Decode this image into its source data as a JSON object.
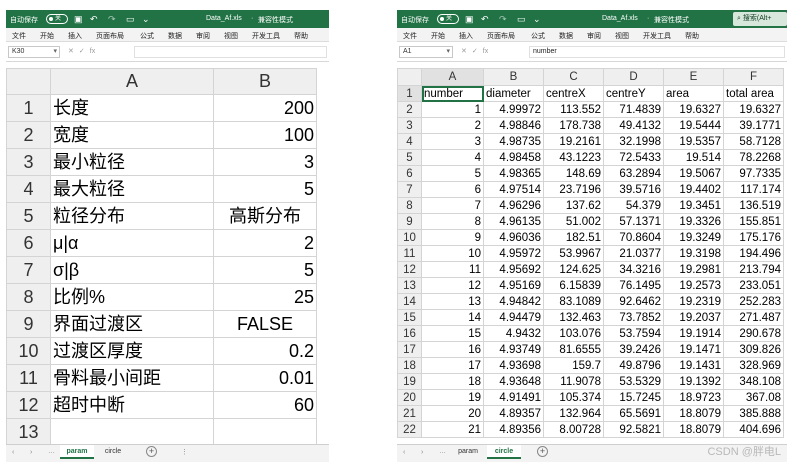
{
  "left_window": {
    "autosave_label": "自动保存",
    "autosave_state": "关",
    "file_title": "Data_Af.xls",
    "mode": "兼容性模式",
    "menu": [
      "文件",
      "开始",
      "插入",
      "页面布局",
      "公式",
      "数据",
      "审阅",
      "视图",
      "开发工具",
      "帮助"
    ],
    "name_box": "K30",
    "formula_value": "",
    "columns": [
      "A",
      "B"
    ],
    "rows": [
      {
        "row": "1",
        "a": "长度",
        "b": "200"
      },
      {
        "row": "2",
        "a": "宽度",
        "b": "100"
      },
      {
        "row": "3",
        "a": "最小粒径",
        "b": "3"
      },
      {
        "row": "4",
        "a": "最大粒径",
        "b": "5"
      },
      {
        "row": "5",
        "a": "粒径分布",
        "b": "高斯分布"
      },
      {
        "row": "6",
        "a": "μ|α",
        "b": "2"
      },
      {
        "row": "7",
        "a": "σ|β",
        "b": "5"
      },
      {
        "row": "8",
        "a": "比例%",
        "b": "25"
      },
      {
        "row": "9",
        "a": "界面过渡区",
        "b": "FALSE"
      },
      {
        "row": "10",
        "a": "过渡区厚度",
        "b": "0.2"
      },
      {
        "row": "11",
        "a": "骨料最小间距",
        "b": "0.01"
      },
      {
        "row": "12",
        "a": "超时中断",
        "b": "60"
      },
      {
        "row": "13",
        "a": "",
        "b": ""
      }
    ],
    "sheet_tabs": [
      "param",
      "circle"
    ],
    "active_tab": "param"
  },
  "right_window": {
    "autosave_label": "自动保存",
    "autosave_state": "关",
    "file_title": "Data_Af.xls",
    "mode": "兼容性模式",
    "search_placeholder": "搜索(Alt+",
    "menu": [
      "文件",
      "开始",
      "插入",
      "页面布局",
      "公式",
      "数据",
      "审阅",
      "视图",
      "开发工具",
      "帮助"
    ],
    "name_box": "A1",
    "formula_value": "number",
    "columns": [
      "A",
      "B",
      "C",
      "D",
      "E",
      "F"
    ],
    "header_row": [
      "number",
      "diameter",
      "centreX",
      "centreY",
      "area",
      "total area"
    ],
    "rows": [
      [
        "1",
        "4.99972",
        "113.552",
        "71.4839",
        "19.6327",
        "19.6327"
      ],
      [
        "2",
        "4.98846",
        "178.738",
        "49.4132",
        "19.5444",
        "39.1771"
      ],
      [
        "3",
        "4.98735",
        "19.2161",
        "32.1998",
        "19.5357",
        "58.7128"
      ],
      [
        "4",
        "4.98458",
        "43.1223",
        "72.5433",
        "19.514",
        "78.2268"
      ],
      [
        "5",
        "4.98365",
        "148.69",
        "63.2894",
        "19.5067",
        "97.7335"
      ],
      [
        "6",
        "4.97514",
        "23.7196",
        "39.5716",
        "19.4402",
        "117.174"
      ],
      [
        "7",
        "4.96296",
        "137.62",
        "54.379",
        "19.3451",
        "136.519"
      ],
      [
        "8",
        "4.96135",
        "51.002",
        "57.1371",
        "19.3326",
        "155.851"
      ],
      [
        "9",
        "4.96036",
        "182.51",
        "70.8604",
        "19.3249",
        "175.176"
      ],
      [
        "10",
        "4.95972",
        "53.9967",
        "21.0377",
        "19.3198",
        "194.496"
      ],
      [
        "11",
        "4.95692",
        "124.625",
        "34.3216",
        "19.2981",
        "213.794"
      ],
      [
        "12",
        "4.95169",
        "6.15839",
        "76.1495",
        "19.2573",
        "233.051"
      ],
      [
        "13",
        "4.94842",
        "83.1089",
        "92.6462",
        "19.2319",
        "252.283"
      ],
      [
        "14",
        "4.94479",
        "132.463",
        "73.7852",
        "19.2037",
        "271.487"
      ],
      [
        "15",
        "4.9432",
        "103.076",
        "53.7594",
        "19.1914",
        "290.678"
      ],
      [
        "16",
        "4.93749",
        "81.6555",
        "39.2426",
        "19.1471",
        "309.826"
      ],
      [
        "17",
        "4.93698",
        "159.7",
        "49.8796",
        "19.1431",
        "328.969"
      ],
      [
        "18",
        "4.93648",
        "11.9078",
        "53.5329",
        "19.1392",
        "348.108"
      ],
      [
        "19",
        "4.91491",
        "105.374",
        "15.7245",
        "18.9723",
        "367.08"
      ],
      [
        "20",
        "4.89357",
        "132.964",
        "65.5691",
        "18.8079",
        "385.888"
      ],
      [
        "21",
        "4.89356",
        "8.00728",
        "92.5821",
        "18.8079",
        "404.696"
      ]
    ],
    "sheet_tabs": [
      "param",
      "circle"
    ],
    "active_tab": "circle"
  },
  "watermark": "CSDN @胖电L"
}
